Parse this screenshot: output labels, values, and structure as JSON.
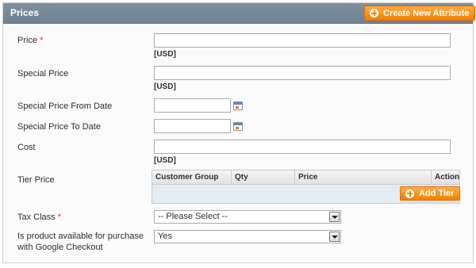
{
  "panel": {
    "title": "Prices",
    "create_attribute_label": "Create New Attribute"
  },
  "fields": {
    "price": {
      "label": "Price",
      "required": "*",
      "value": "",
      "note": "[USD]"
    },
    "special_price": {
      "label": "Special Price",
      "value": "",
      "note": "[USD]"
    },
    "special_from": {
      "label": "Special Price From Date",
      "value": ""
    },
    "special_to": {
      "label": "Special Price To Date",
      "value": ""
    },
    "cost": {
      "label": "Cost",
      "value": "",
      "note": "[USD]"
    },
    "tier_price": {
      "label": "Tier Price",
      "columns": [
        "Customer Group",
        "Qty",
        "Price",
        "Action"
      ],
      "add_label": "Add Tier"
    },
    "tax_class": {
      "label": "Tax Class",
      "required": "*",
      "selected": "-- Please Select --"
    },
    "google_checkout": {
      "label_line1": "Is product available for purchase",
      "label_line2": "with Google Checkout",
      "selected": "Yes"
    }
  },
  "icons": {
    "add": "plus-circle-icon",
    "calendar": "calendar-icon",
    "dropdown": "chevron-down-icon"
  },
  "colors": {
    "header_bg": "#7e909e",
    "button_bg": "#f18200",
    "required": "#eb340a"
  }
}
